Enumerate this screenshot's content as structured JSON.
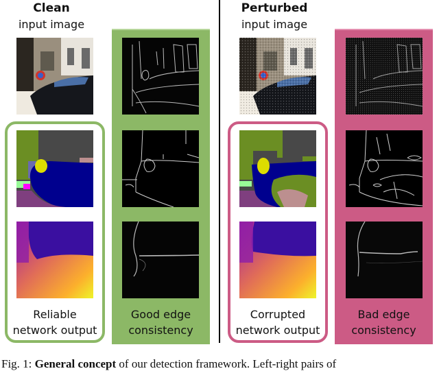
{
  "figure": {
    "left": {
      "title_bold": "Clean",
      "title_sub": "input image",
      "output_label_line1": "Reliable",
      "output_label_line2": "network output",
      "edge_label_line1": "Good edge",
      "edge_label_line2": "consistency",
      "accent_color": "#8cb866"
    },
    "right": {
      "title_bold": "Perturbed",
      "title_sub": "input image",
      "output_label_line1": "Corrupted",
      "output_label_line2": "network output",
      "edge_label_line1": "Bad edge",
      "edge_label_line2": "consistency",
      "accent_color": "#cc5b85"
    },
    "images": [
      {
        "name": "clean-input-image",
        "description": "street scene with parked dark car and sign"
      },
      {
        "name": "clean-input-edges",
        "description": "edge map of clean input"
      },
      {
        "name": "clean-segmentation",
        "description": "semantic segmentation output"
      },
      {
        "name": "clean-segmentation-edges",
        "description": "edge map of segmentation"
      },
      {
        "name": "clean-depth",
        "description": "depth prediction (plasma colormap)"
      },
      {
        "name": "clean-depth-edges",
        "description": "edge map of depth"
      },
      {
        "name": "perturbed-input-image",
        "description": "noisy street scene"
      },
      {
        "name": "perturbed-input-edges",
        "description": "noisy edge map"
      },
      {
        "name": "perturbed-segmentation",
        "description": "corrupted segmentation"
      },
      {
        "name": "perturbed-segmentation-edges",
        "description": "corrupted segmentation edges"
      },
      {
        "name": "perturbed-depth",
        "description": "corrupted depth prediction"
      },
      {
        "name": "perturbed-depth-edges",
        "description": "corrupted depth edges"
      }
    ]
  },
  "caption": {
    "prefix": "Fig. 1: ",
    "bold": "General concept",
    "rest": " of our detection framework. Left-right pairs of"
  }
}
